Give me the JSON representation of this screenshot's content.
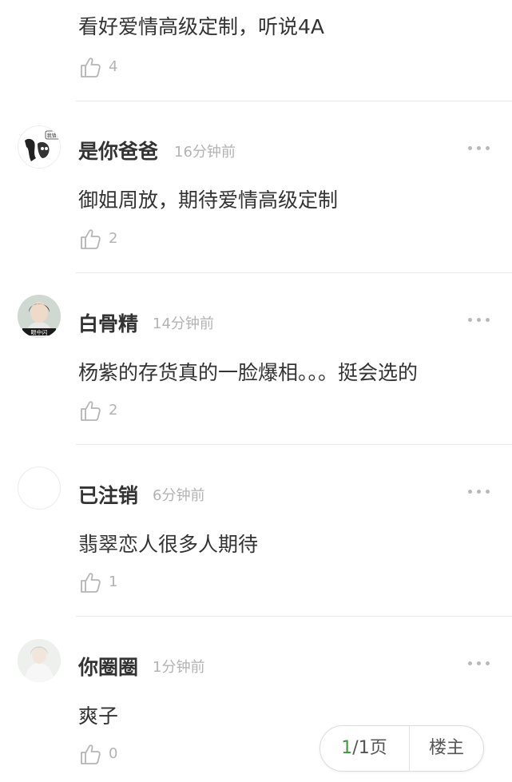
{
  "comments": [
    {
      "username": "",
      "time": "",
      "content": "看好爱情高级定制，听说4A",
      "likes": "4"
    },
    {
      "username": "是你爸爸",
      "time": "16分钟前",
      "content": "御姐周放，期待爱情高级定制",
      "likes": "2",
      "avatar_badge": "我错!"
    },
    {
      "username": "白骨精",
      "time": "14分钟前",
      "content": "杨紫的存货真的一脸爆相。。。挺会选的",
      "likes": "2",
      "avatar_caption": "眼中闪"
    },
    {
      "username": "已注销",
      "time": "6分钟前",
      "content": "翡翠恋人很多人期待",
      "likes": "1"
    },
    {
      "username": "你圈圈",
      "time": "1分钟前",
      "content": "爽子",
      "likes": "0"
    }
  ],
  "pager": {
    "current": "1",
    "total_suffix": "/1页",
    "op_label": "楼主"
  },
  "colors": {
    "text": "#333333",
    "meta": "#b3b3b3",
    "accent": "#3d9a3d",
    "divider": "#e8e8e8"
  },
  "icons": {
    "like": "thumb-up-icon",
    "more": "more-dots-icon"
  }
}
